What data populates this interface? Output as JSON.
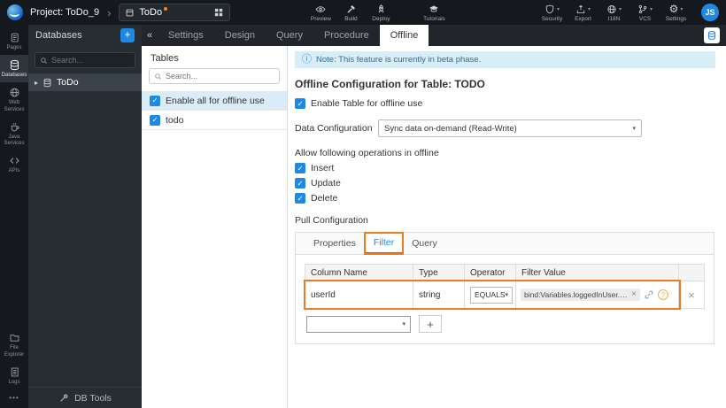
{
  "topbar": {
    "project_label": "Project: ToDo_9",
    "app_name": "ToDo",
    "actions": [
      {
        "label": "Preview"
      },
      {
        "label": "Build"
      },
      {
        "label": "Deploy"
      }
    ],
    "tutorials_label": "Tutorials",
    "right_actions": [
      {
        "label": "Security"
      },
      {
        "label": "Export"
      },
      {
        "label": "I18N"
      },
      {
        "label": "VCS"
      },
      {
        "label": "Settings"
      }
    ],
    "avatar_initials": "JS"
  },
  "rail": {
    "items": [
      {
        "label": "Pages"
      },
      {
        "label": "Databases"
      },
      {
        "label": "Web Services"
      },
      {
        "label": "Java Services"
      },
      {
        "label": "APIs"
      }
    ],
    "bottom_items": [
      {
        "label": "File Explorer"
      },
      {
        "label": "Logs"
      }
    ],
    "more": "•••"
  },
  "db_panel": {
    "title": "Databases",
    "add_label": "+",
    "search_placeholder": "Search...",
    "tree_item": "ToDo",
    "db_tools_label": "DB Tools"
  },
  "main_tabs": {
    "collapse": "«",
    "items": [
      {
        "label": "Settings"
      },
      {
        "label": "Design"
      },
      {
        "label": "Query"
      },
      {
        "label": "Procedure"
      },
      {
        "label": "Offline"
      }
    ]
  },
  "tables_panel": {
    "title": "Tables",
    "search_placeholder": "Search...",
    "rows": [
      {
        "label": "Enable all for offline use"
      },
      {
        "label": "todo"
      }
    ]
  },
  "offline": {
    "note": "Note: This feature is currently in beta phase.",
    "heading": "Offline Configuration for Table: TODO",
    "enable_label": "Enable Table for offline use",
    "data_config_label": "Data Configuration",
    "data_config_value": "Sync data on-demand (Read-Write)",
    "operations_label": "Allow following operations in offline",
    "operations": [
      {
        "label": "Insert"
      },
      {
        "label": "Update"
      },
      {
        "label": "Delete"
      }
    ],
    "pull_label": "Pull Configuration",
    "pull_tabs": [
      {
        "label": "Properties"
      },
      {
        "label": "Filter"
      },
      {
        "label": "Query"
      }
    ],
    "filter_table": {
      "headers": [
        "Column Name",
        "Type",
        "Operator",
        "Filter Value"
      ],
      "row": {
        "column_name": "userId",
        "type": "string",
        "operator": "EQUALS",
        "filter_value": "bind:Variables.loggedInUser.data"
      },
      "add_label": "+"
    }
  },
  "icons": {
    "check": "✓",
    "caret": "▾",
    "remove": "×",
    "chevron_right": "›",
    "expander": "▸",
    "info": "ⓘ",
    "question": "?",
    "gear": "⚙"
  },
  "colors": {
    "accent_blue": "#1e88e5",
    "annotation_orange": "#ee7b1d",
    "note_bg": "#d9edf7",
    "topbar_bg": "#15181c",
    "panel_bg": "#272d33"
  }
}
